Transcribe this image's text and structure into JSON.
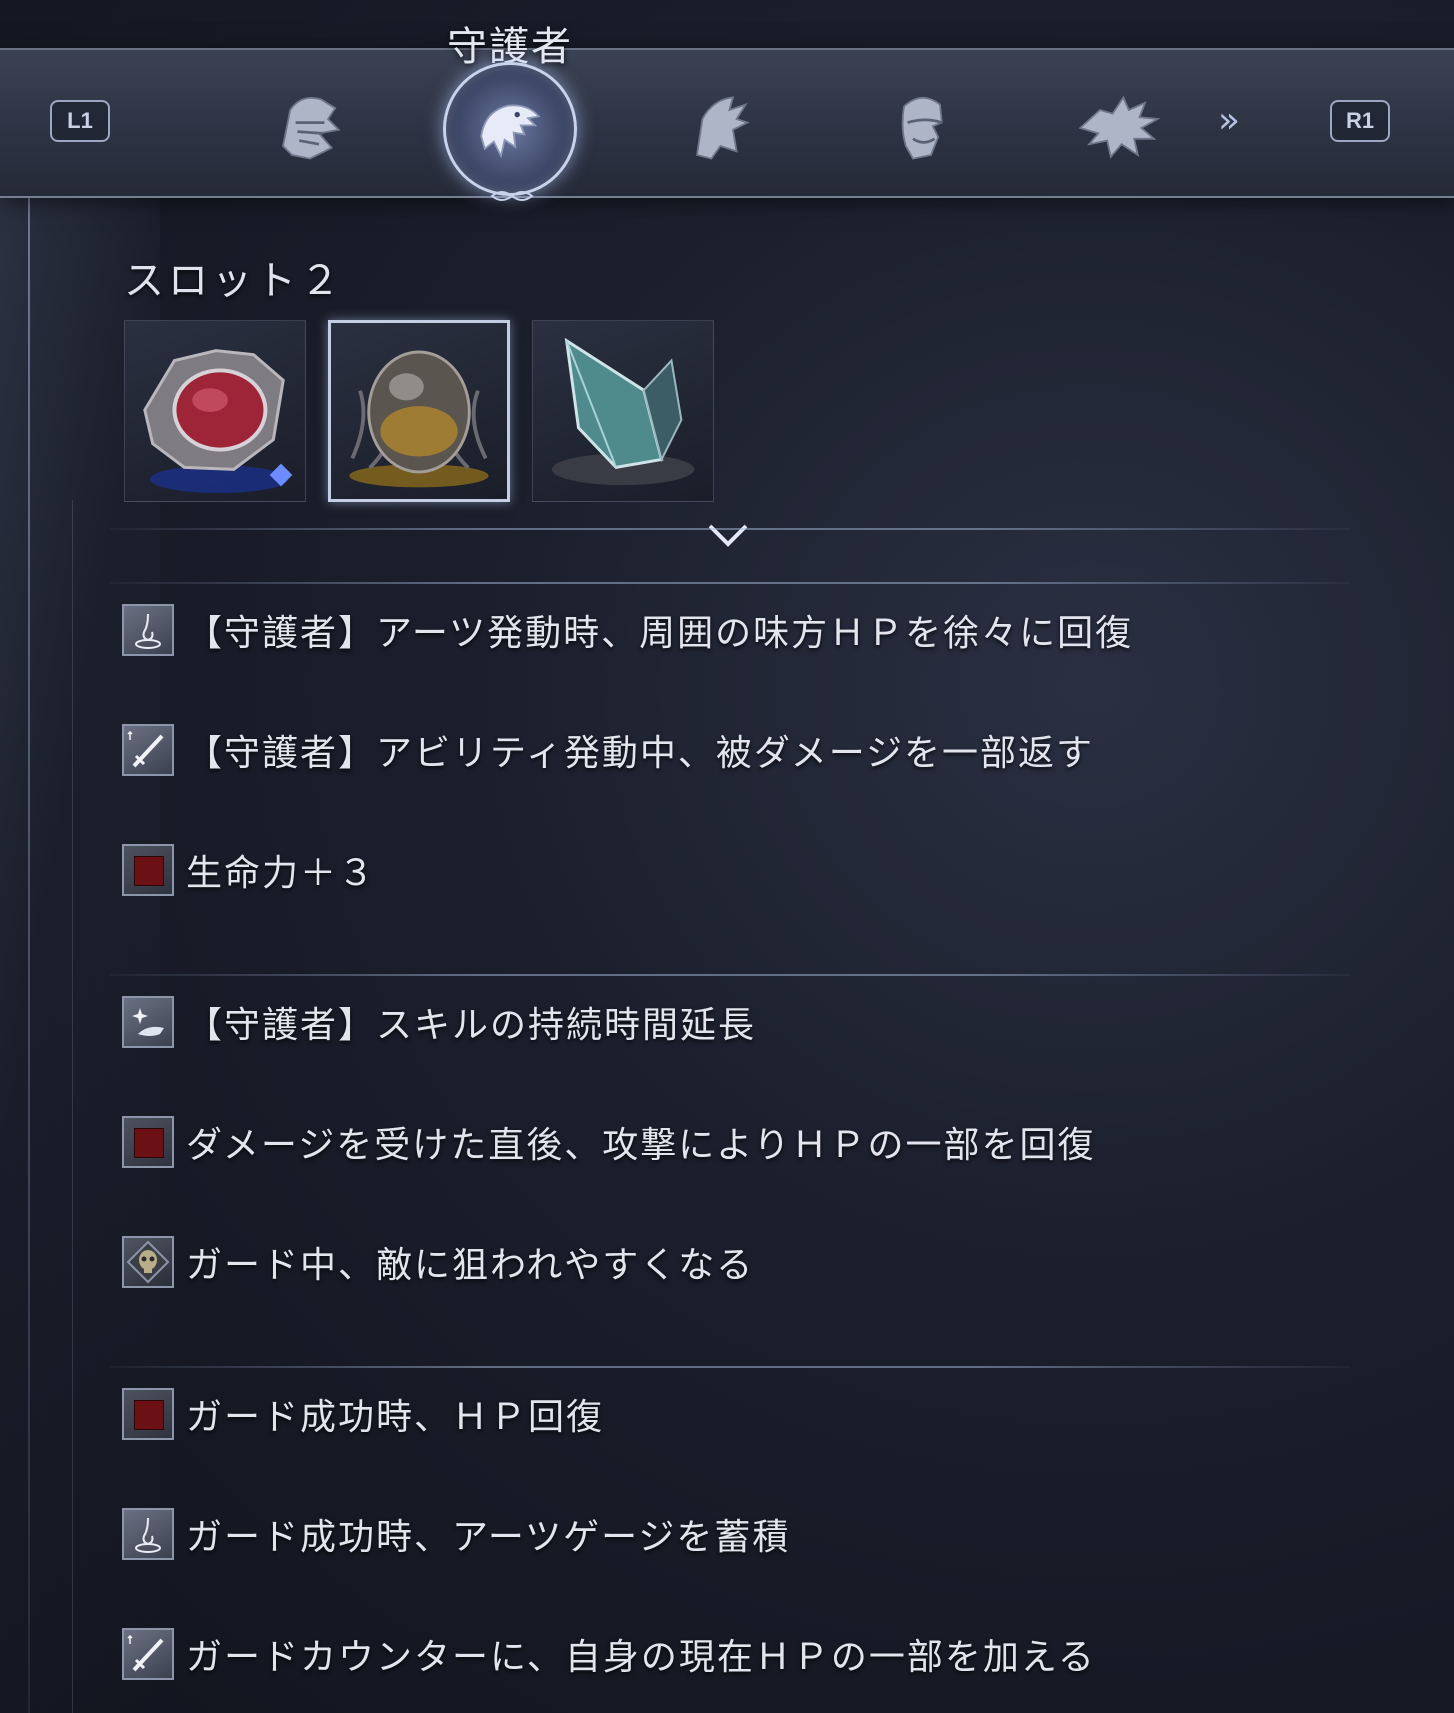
{
  "header": {
    "class_title": "守護者",
    "left_shoulder": "L1",
    "right_shoulder": "R1",
    "next_glyph": "»",
    "classes": [
      {
        "icon": "helmet-icon",
        "selected": false
      },
      {
        "icon": "eagle-icon",
        "selected": true
      },
      {
        "icon": "hooded-figure-icon",
        "selected": false
      },
      {
        "icon": "masked-face-icon",
        "selected": false
      },
      {
        "icon": "dragon-icon",
        "selected": false
      }
    ]
  },
  "slot": {
    "title": "スロット２",
    "gems": [
      {
        "icon": "ruby-brooch-icon",
        "selected": false
      },
      {
        "icon": "amber-egg-icon",
        "selected": true
      },
      {
        "icon": "crystal-shard-icon",
        "selected": false
      }
    ]
  },
  "skills": [
    {
      "icon": "water-drop-icon",
      "text": "【守護者】アーツ発動時、周囲の味方ＨＰを徐々に回復"
    },
    {
      "icon": "sword-icon",
      "text": "【守護者】アビリティ発動中、被ダメージを一部返す"
    },
    {
      "icon": "red-square-icon",
      "text": "生命力＋３"
    },
    {
      "icon": "sparkle-hand-icon",
      "text": "【守護者】スキルの持続時間延長"
    },
    {
      "icon": "red-square-icon",
      "text": "ダメージを受けた直後、攻撃によりＨＰの一部を回復"
    },
    {
      "icon": "skull-icon",
      "text": "ガード中、敵に狙われやすくなる"
    },
    {
      "icon": "red-square-icon",
      "text": "ガード成功時、ＨＰ回復"
    },
    {
      "icon": "water-drop-icon",
      "text": "ガード成功時、アーツゲージを蓄積"
    },
    {
      "icon": "sword-icon",
      "text": "ガードカウンターに、自身の現在ＨＰの一部を加える"
    }
  ]
}
